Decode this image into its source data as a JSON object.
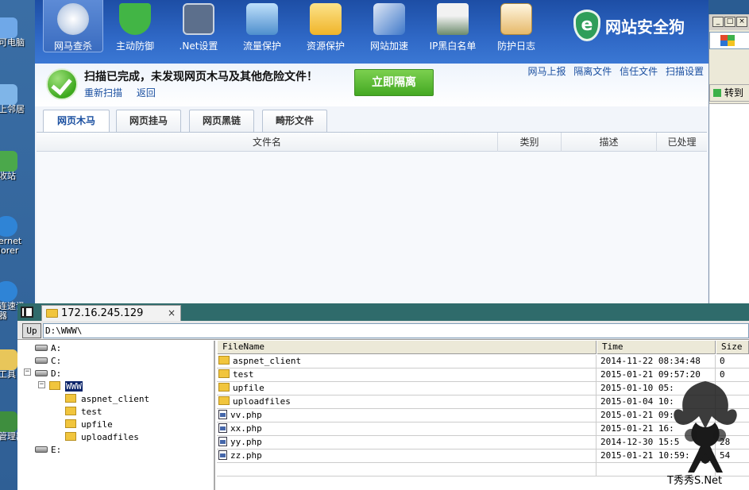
{
  "desktop": {
    "icons": [
      {
        "label": "可电脑",
        "color": "#6fa8e8"
      },
      {
        "label": "上邻居",
        "color": "#7fb5e8"
      },
      {
        "label": "收站",
        "color": "#4ba84b"
      },
      {
        "label": "ernet",
        "label2": "lorer",
        "color": "#2f84d6"
      },
      {
        "label": "连速讯",
        "label2": "器",
        "color": "#2f84d6"
      },
      {
        "label": "工具",
        "color": "#e8c65a"
      },
      {
        "label": "管理器",
        "color": "#3e8e3e"
      }
    ]
  },
  "toolbar": {
    "items": [
      {
        "label": "网马查杀",
        "icon": "radar-scan-icon",
        "color": "#d8e2ef"
      },
      {
        "label": "主动防御",
        "icon": "shield-icon",
        "color": "#42b545"
      },
      {
        "label": ".Net设置",
        "icon": "net-settings-icon",
        "color": "#5c6f8c"
      },
      {
        "label": "流量保护",
        "icon": "traffic-chart-icon",
        "color": "#7ab2e0"
      },
      {
        "label": "资源保护",
        "icon": "folder-check-icon",
        "color": "#f3c54e"
      },
      {
        "label": "网站加速",
        "icon": "rocket-icon",
        "color": "#3f78c9"
      },
      {
        "label": "IP黑白名单",
        "icon": "router-icon",
        "color": "#6c8b6c"
      },
      {
        "label": "防护日志",
        "icon": "clipboard-log-icon",
        "color": "#e6b96a"
      }
    ],
    "brand": {
      "badge": "e",
      "name": "网站安全狗"
    }
  },
  "status": {
    "message": "扫描已完成，未发现网页木马及其他危险文件！",
    "rescan": "重新扫描",
    "back": "返回",
    "isolate_button": "立即隔离",
    "links": [
      "网马上报",
      "隔离文件",
      "信任文件",
      "扫描设置"
    ]
  },
  "tabs": [
    "网页木马",
    "网页挂马",
    "网页黑链",
    "畸形文件"
  ],
  "result_table": {
    "columns": [
      "文件名",
      "类别",
      "描述",
      "已处理"
    ]
  },
  "side_window": {
    "buttons": [
      "_",
      "□",
      "×"
    ],
    "goto": "转到"
  },
  "file_manager": {
    "tab_label": "172.16.245.129",
    "tab_close": "×",
    "up_button": "Up",
    "path": "D:\\WWW\\",
    "tree": {
      "drives": [
        "A:",
        "C:",
        "D:",
        "E:"
      ],
      "selected": "WWW",
      "children": [
        "aspnet_client",
        "test",
        "upfile",
        "uploadfiles"
      ]
    },
    "columns": [
      "FileName",
      "Time",
      "Size"
    ],
    "files": [
      {
        "name": "aspnet_client",
        "type": "dir",
        "time": "2014-11-22 08:34:48",
        "size": "0"
      },
      {
        "name": "test",
        "type": "dir",
        "time": "2015-01-21 09:57:20",
        "size": "0"
      },
      {
        "name": "upfile",
        "type": "dir",
        "time": "2015-01-10 05:",
        "size": ""
      },
      {
        "name": "uploadfiles",
        "type": "dir",
        "time": "2015-01-04 10:",
        "size": ""
      },
      {
        "name": "vv.php",
        "type": "php",
        "time": "2015-01-21 09:",
        "size": ""
      },
      {
        "name": "xx.php",
        "type": "php",
        "time": "2015-01-21 16:",
        "size": ""
      },
      {
        "name": "yy.php",
        "type": "php",
        "time": "2014-12-30 15:5",
        "size": "28"
      },
      {
        "name": "zz.php",
        "type": "php",
        "time": "2015-01-21 10:59:",
        "size": "54"
      }
    ]
  },
  "watermark": {
    "text": "T秀秀S.Net"
  }
}
